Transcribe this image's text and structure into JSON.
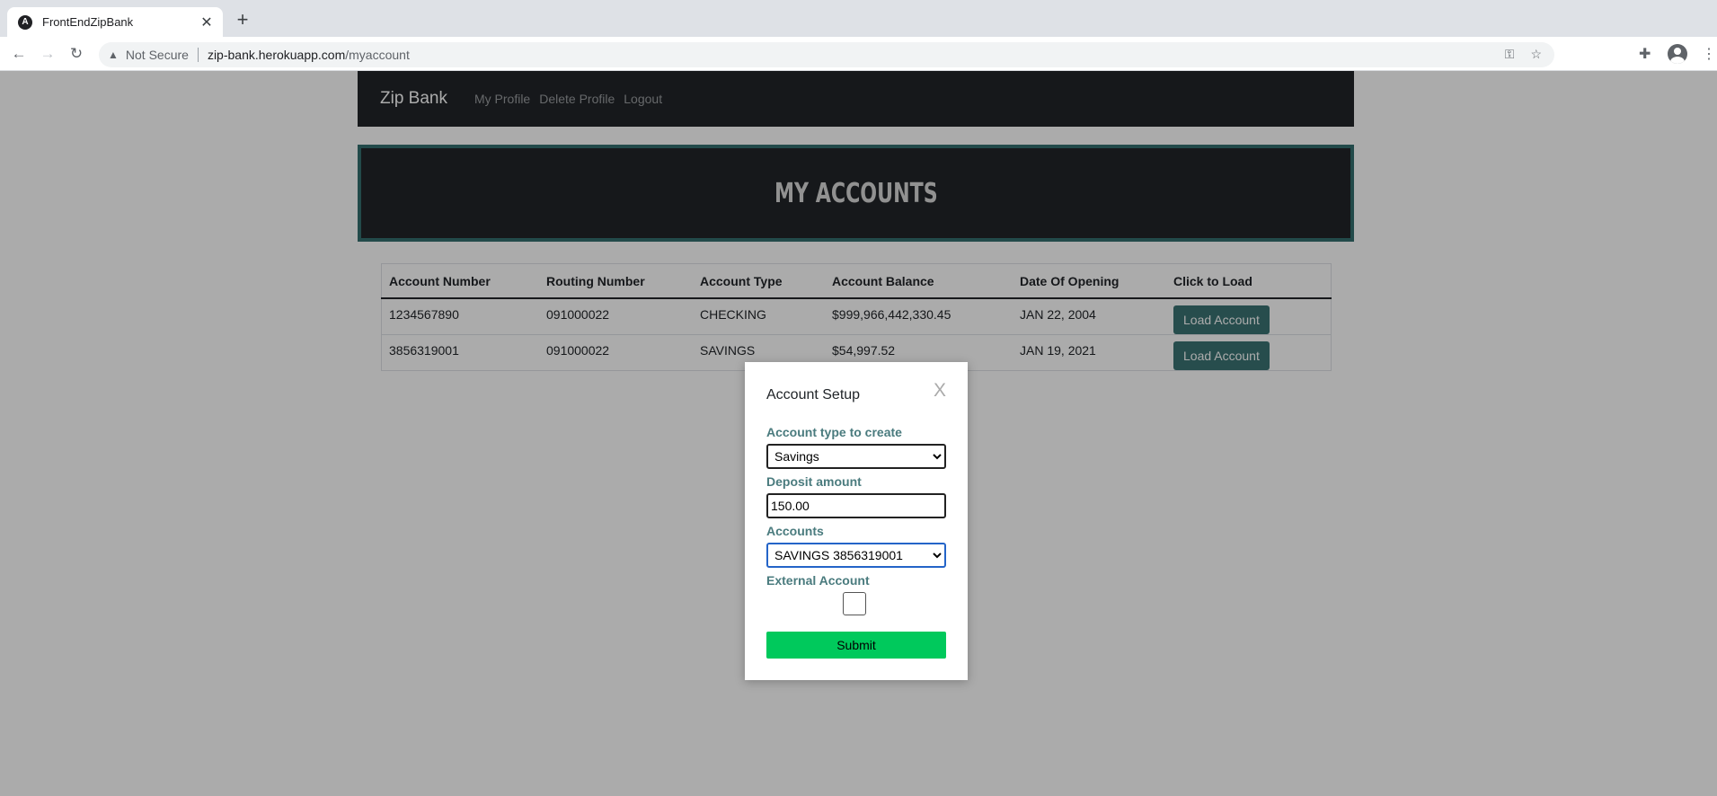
{
  "browser": {
    "tab_title": "FrontEndZipBank",
    "tab_favicon": "A",
    "security_label": "Not Secure",
    "url_host": "zip-bank.herokuapp.com",
    "url_path": "/myaccount"
  },
  "navbar": {
    "brand": "Zip Bank",
    "links": [
      "My Profile",
      "Delete Profile",
      "Logout"
    ]
  },
  "hero": {
    "title": "MY ACCOUNTS"
  },
  "table": {
    "headers": [
      "Account Number",
      "Routing Number",
      "Account Type",
      "Account Balance",
      "Date Of Opening",
      "Click to Load"
    ],
    "rows": [
      {
        "account_number": "1234567890",
        "routing_number": "091000022",
        "account_type": "CHECKING",
        "balance": "$999,966,442,330.45",
        "date_opened": "JAN 22, 2004",
        "button": "Load Account"
      },
      {
        "account_number": "3856319001",
        "routing_number": "091000022",
        "account_type": "SAVINGS",
        "balance": "$54,997.52",
        "date_opened": "JAN 19, 2021",
        "button": "Load Account"
      }
    ]
  },
  "modal": {
    "title": "Account Setup",
    "close": "X",
    "account_type_label": "Account type to create",
    "account_type_value": "Savings",
    "deposit_label": "Deposit amount",
    "deposit_value": "150.00",
    "accounts_label": "Accounts",
    "accounts_value": "SAVINGS 3856319001",
    "external_label": "External Account",
    "external_checked": false,
    "submit": "Submit"
  },
  "colors": {
    "navbar_bg": "#212529",
    "hero_border": "#336f6f",
    "button_teal": "#3b7474",
    "submit_green": "#00c95c",
    "label_teal": "#4a7b7e"
  }
}
